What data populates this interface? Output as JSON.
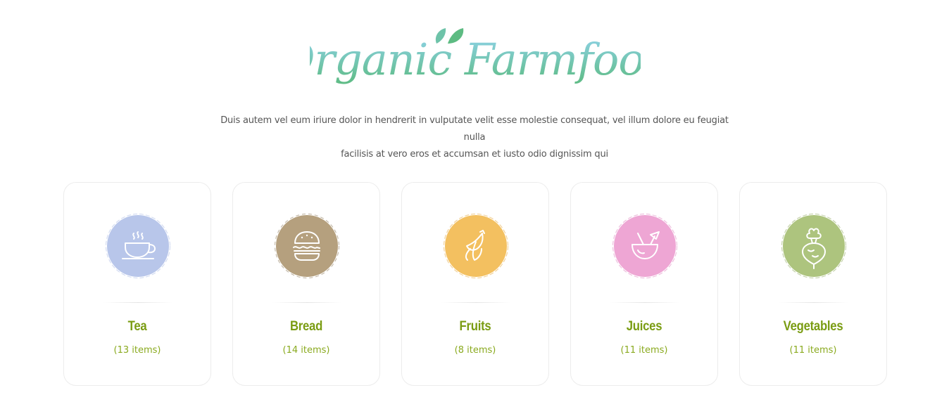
{
  "brand": {
    "logo_text": "Organic Farmfood",
    "logo_icon": "leaf-icon",
    "gradient": [
      "#7fcfe6",
      "#5dbb82"
    ]
  },
  "intro": {
    "line1": "Duis autem vel eum iriure dolor in hendrerit in vulputate velit esse molestie consequat, vel illum dolore eu feugiat nulla",
    "line2": "facilisis at vero eros et accumsan et iusto odio dignissim qui"
  },
  "accent_color": "#7a9c12",
  "categories": [
    {
      "name": "Tea",
      "count": "(13 items)",
      "icon": "tea-cup-icon",
      "color": "#b8c6ea"
    },
    {
      "name": "Bread",
      "count": "(14 items)",
      "icon": "burger-icon",
      "color": "#b5a07e"
    },
    {
      "name": "Fruits",
      "count": "(8 items)",
      "icon": "banana-icon",
      "color": "#f3c060"
    },
    {
      "name": "Juices",
      "count": "(11 items)",
      "icon": "coconut-drink-icon",
      "color": "#eea6d4"
    },
    {
      "name": "Vegetables",
      "count": "(11 items)",
      "icon": "beet-icon",
      "color": "#adc47e"
    }
  ]
}
